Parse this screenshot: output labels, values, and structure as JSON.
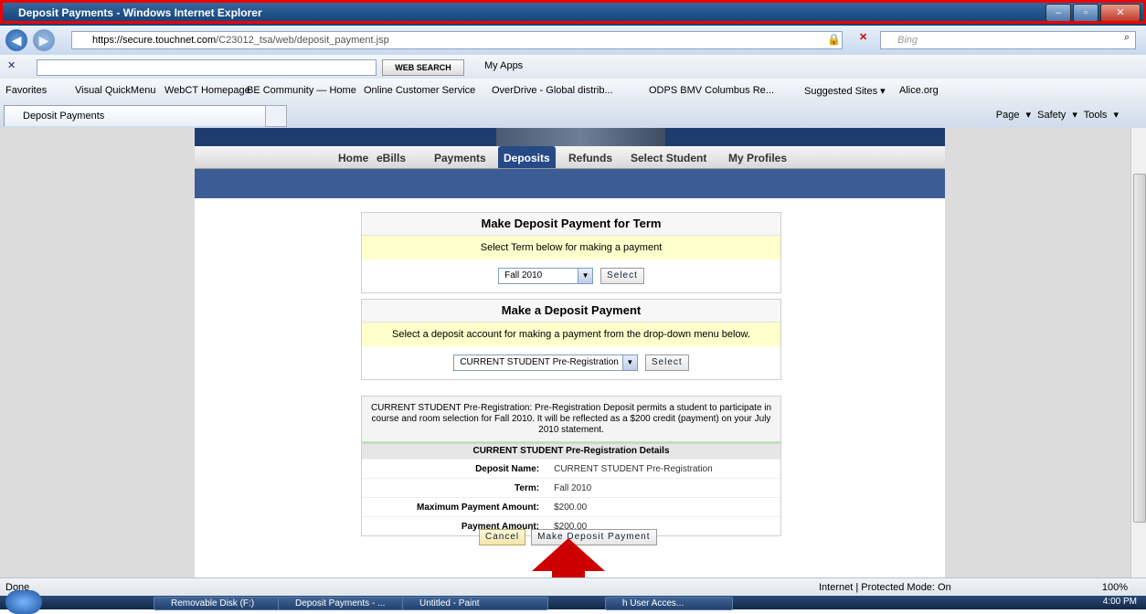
{
  "window": {
    "title": "Deposit Payments - Windows Internet Explorer"
  },
  "address": {
    "url_host": "https://secure.touchnet.com",
    "url_path": "/C23012_tsa/web/deposit_payment.jsp",
    "search_placeholder": "Bing"
  },
  "toolbar": {
    "web_search": "WEB SEARCH",
    "my_apps": "My Apps"
  },
  "favorites": {
    "label": "Favorites",
    "items": [
      "Visual QuickMenu",
      "WebCT Homepage",
      "BE Community — Home",
      "Online Customer Service",
      "OverDrive - Global distrib...",
      "ODPS BMV Columbus Re...",
      "Suggested Sites ▾",
      "Alice.org"
    ]
  },
  "tab": {
    "label": "Deposit Payments"
  },
  "commands": {
    "page": "Page ▾",
    "safety": "Safety ▾",
    "tools": "Tools ▾"
  },
  "nav": {
    "items": [
      "Home",
      "eBills",
      "Payments",
      "Deposits",
      "Refunds",
      "Select Student",
      "My Profiles"
    ],
    "active": "Deposits"
  },
  "term_panel": {
    "title": "Make Deposit Payment for Term",
    "note": "Select Term below for making a payment",
    "selected": "Fall 2010",
    "button": "Select"
  },
  "deposit_panel": {
    "title": "Make a Deposit Payment",
    "note": "Select a deposit account for making a payment from the drop-down menu below.",
    "selected": "CURRENT STUDENT Pre-Registration",
    "button": "Select"
  },
  "detail": {
    "description": "CURRENT STUDENT Pre-Registration:  Pre-Registration Deposit permits a student to participate in course and room selection for Fall 2010. It will be reflected as a $200 credit (payment) on your July 2010 statement.",
    "header": "CURRENT STUDENT Pre-Registration Details",
    "rows": [
      {
        "label": "Deposit Name:",
        "value": "CURRENT STUDENT Pre-Registration"
      },
      {
        "label": "Term:",
        "value": "Fall 2010"
      },
      {
        "label": "Maximum Payment Amount:",
        "value": "$200.00"
      },
      {
        "label": "Payment Amount:",
        "value": "$200.00"
      }
    ]
  },
  "actions": {
    "cancel": "Cancel",
    "submit": "Make Deposit Payment"
  },
  "status": {
    "left": "Done",
    "zone": "Internet | Protected Mode: On",
    "zoom": "100%"
  },
  "taskbar": {
    "items": [
      "Removable Disk (F:)",
      "Deposit Payments - ...",
      "Untitled - Paint",
      "h User Acces..."
    ],
    "clock": "4:00 PM"
  },
  "colors": {
    "nav_active": "#274a86",
    "note_bg": "#ffffcc",
    "annotation": "#cc0000"
  }
}
